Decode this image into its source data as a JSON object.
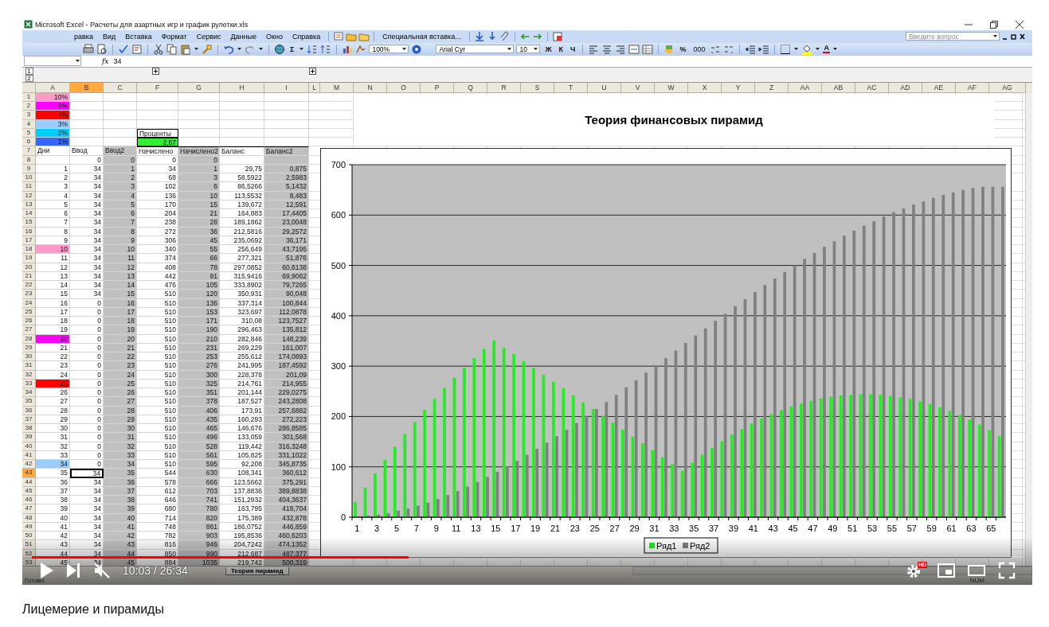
{
  "video": {
    "window": {
      "title": "Microsoft Excel - Расчеты для азартных игр и график рулетки.xls"
    },
    "menu": [
      "равка",
      "Вид",
      "Вставка",
      "Формат",
      "Сервис",
      "Данные",
      "Окно",
      "Справка"
    ],
    "special_paste": "Специальная вставка...",
    "help_search": {
      "placeholder": "Введите вопрос"
    },
    "toolbar": {
      "sum": "Σ",
      "zoom": "100%",
      "font": "Arial Cyr",
      "font_size": "10",
      "format_buttons": [
        "Ж",
        "К",
        "Ч"
      ],
      "percent": "%",
      "thousands": "000",
      "font_color_letter": "A"
    },
    "formula_bar": {
      "fx": "fx",
      "value": "34"
    },
    "outline_levels": [
      "1",
      "2"
    ],
    "columns": [
      {
        "label": "A",
        "selected": false,
        "shaded": false
      },
      {
        "label": "B",
        "selected": true,
        "shaded": false
      },
      {
        "label": "C",
        "selected": false,
        "shaded": true
      },
      {
        "label": "F",
        "selected": false,
        "shaded": false
      },
      {
        "label": "G",
        "selected": false,
        "shaded": true
      },
      {
        "label": "H",
        "selected": false,
        "shaded": false
      },
      {
        "label": "I",
        "selected": false,
        "shaded": true
      },
      {
        "label": "L",
        "selected": false
      },
      {
        "label": "M",
        "selected": false
      },
      {
        "label": "N",
        "selected": false
      },
      {
        "label": "O",
        "selected": false
      },
      {
        "label": "P",
        "selected": false
      },
      {
        "label": "Q",
        "selected": false
      },
      {
        "label": "R",
        "selected": false
      },
      {
        "label": "S",
        "selected": false
      },
      {
        "label": "T",
        "selected": false
      },
      {
        "label": "U",
        "selected": false
      },
      {
        "label": "V",
        "selected": false
      },
      {
        "label": "W",
        "selected": false
      },
      {
        "label": "X",
        "selected": false
      },
      {
        "label": "Y",
        "selected": false
      },
      {
        "label": "Z",
        "selected": false
      },
      {
        "label": "AA",
        "selected": false
      },
      {
        "label": "AB",
        "selected": false
      },
      {
        "label": "AC",
        "selected": false
      },
      {
        "label": "AD",
        "selected": false
      },
      {
        "label": "AE",
        "selected": false
      },
      {
        "label": "AF",
        "selected": false
      },
      {
        "label": "AG",
        "selected": false
      }
    ],
    "rows": [
      {
        "n": "1",
        "selected": false,
        "kind": "top",
        "cells": [
          {
            "text": "10%",
            "color": "#ff99cc"
          },
          null,
          null,
          null,
          null,
          null,
          null
        ]
      },
      {
        "n": "2",
        "selected": false,
        "kind": "top",
        "cells": [
          {
            "text": "5%",
            "color": "#ff00ff"
          },
          null,
          null,
          null,
          null,
          null,
          null
        ]
      },
      {
        "n": "3",
        "selected": false,
        "kind": "top",
        "cells": [
          {
            "text": "4%",
            "color": "#ff0000"
          },
          null,
          null,
          null,
          null,
          null,
          null
        ]
      },
      {
        "n": "4",
        "selected": false,
        "kind": "top",
        "cells": [
          {
            "text": "3%",
            "color": "#99ccff"
          },
          null,
          null,
          null,
          null,
          null,
          null
        ]
      },
      {
        "n": "5",
        "selected": false,
        "kind": "top",
        "cells": [
          {
            "text": "2%",
            "color": "#00ccff"
          },
          null,
          null,
          {
            "text": "Проценты",
            "kind": "label"
          },
          null,
          null,
          null
        ]
      },
      {
        "n": "6",
        "selected": false,
        "kind": "top",
        "cells": [
          {
            "text": "1%",
            "color": "#3366ff"
          },
          null,
          null,
          {
            "text": "2,67",
            "kind": "value",
            "color": "#33ee33"
          },
          null,
          null,
          null
        ]
      },
      {
        "n": "7",
        "selected": false,
        "kind": "header",
        "cells": [
          "Дни",
          "Ввод",
          "Ввод2",
          "Начислено",
          "Начислено2",
          "Баланс",
          "Баланс2"
        ]
      },
      {
        "n": "8",
        "selected": false,
        "kind": "data",
        "cells": [
          null,
          "0",
          "0",
          "0",
          "0",
          null,
          null
        ]
      },
      {
        "n": "9",
        "selected": false,
        "kind": "data",
        "cells": [
          "1",
          "34",
          "1",
          "34",
          "1",
          "29,75",
          "0,875"
        ]
      },
      {
        "n": "10",
        "selected": false,
        "kind": "data",
        "cells": [
          "2",
          "34",
          "2",
          "68",
          "3",
          "58,5922",
          "2,5983"
        ]
      },
      {
        "n": "11",
        "selected": false,
        "kind": "data",
        "cells": [
          "3",
          "34",
          "3",
          "102",
          "6",
          "86,5266",
          "5,1432"
        ]
      },
      {
        "n": "12",
        "selected": false,
        "kind": "data",
        "cells": [
          "4",
          "34",
          "4",
          "136",
          "10",
          "113,5532",
          "8,483"
        ]
      },
      {
        "n": "13",
        "selected": false,
        "kind": "data",
        "cells": [
          "5",
          "34",
          "5",
          "170",
          "15",
          "139,672",
          "12,591"
        ]
      },
      {
        "n": "14",
        "selected": false,
        "kind": "data",
        "cells": [
          "6",
          "34",
          "6",
          "204",
          "21",
          "164,883",
          "17,4405"
        ]
      },
      {
        "n": "15",
        "selected": false,
        "kind": "data",
        "cells": [
          "7",
          "34",
          "7",
          "238",
          "28",
          "189,1862",
          "23,0048"
        ]
      },
      {
        "n": "16",
        "selected": false,
        "kind": "data",
        "cells": [
          "8",
          "34",
          "8",
          "272",
          "36",
          "212,5816",
          "29,2572"
        ]
      },
      {
        "n": "17",
        "selected": false,
        "kind": "data",
        "cells": [
          "9",
          "34",
          "9",
          "306",
          "45",
          "235,0692",
          "36,171"
        ]
      },
      {
        "n": "18",
        "selected": false,
        "kind": "data",
        "cells": [
          {
            "text": "10",
            "color": "#ff99cc"
          },
          "34",
          "10",
          "340",
          "55",
          "256,649",
          "43,7195"
        ]
      },
      {
        "n": "19",
        "selected": false,
        "kind": "data",
        "cells": [
          "11",
          "34",
          "11",
          "374",
          "66",
          "277,321",
          "51,876"
        ]
      },
      {
        "n": "20",
        "selected": false,
        "kind": "data",
        "cells": [
          "12",
          "34",
          "12",
          "408",
          "78",
          "297,0852",
          "60,6138"
        ]
      },
      {
        "n": "21",
        "selected": false,
        "kind": "data",
        "cells": [
          "13",
          "34",
          "13",
          "442",
          "91",
          "315,9416",
          "69,9062"
        ]
      },
      {
        "n": "22",
        "selected": false,
        "kind": "data",
        "cells": [
          "14",
          "34",
          "14",
          "476",
          "105",
          "333,8902",
          "79,7265"
        ]
      },
      {
        "n": "23",
        "selected": false,
        "kind": "data",
        "cells": [
          "15",
          "34",
          "15",
          "510",
          "120",
          "350,931",
          "90,048"
        ]
      },
      {
        "n": "24",
        "selected": false,
        "kind": "data",
        "cells": [
          "16",
          "0",
          "16",
          "510",
          "136",
          "337,314",
          "100,844"
        ]
      },
      {
        "n": "25",
        "selected": false,
        "kind": "data",
        "cells": [
          "17",
          "0",
          "17",
          "510",
          "153",
          "323,697",
          "112,0878"
        ]
      },
      {
        "n": "26",
        "selected": false,
        "kind": "data",
        "cells": [
          "18",
          "0",
          "18",
          "510",
          "171",
          "310,08",
          "123,7527"
        ]
      },
      {
        "n": "27",
        "selected": false,
        "kind": "data",
        "cells": [
          "19",
          "0",
          "19",
          "510",
          "190",
          "296,463",
          "135,812"
        ]
      },
      {
        "n": "28",
        "selected": false,
        "kind": "data",
        "cells": [
          {
            "text": "20",
            "color": "#ff00ff"
          },
          "0",
          "20",
          "510",
          "210",
          "282,846",
          "148,239"
        ]
      },
      {
        "n": "29",
        "selected": false,
        "kind": "data",
        "cells": [
          "21",
          "0",
          "21",
          "510",
          "231",
          "269,229",
          "161,007"
        ]
      },
      {
        "n": "30",
        "selected": false,
        "kind": "data",
        "cells": [
          "22",
          "0",
          "22",
          "510",
          "253",
          "255,612",
          "174,0893"
        ]
      },
      {
        "n": "31",
        "selected": false,
        "kind": "data",
        "cells": [
          "23",
          "0",
          "23",
          "510",
          "276",
          "241,995",
          "187,4592"
        ]
      },
      {
        "n": "32",
        "selected": false,
        "kind": "data",
        "cells": [
          "24",
          "0",
          "24",
          "510",
          "300",
          "228,378",
          "201,09"
        ]
      },
      {
        "n": "33",
        "selected": false,
        "kind": "data",
        "cells": [
          {
            "text": "25",
            "color": "#ff0000"
          },
          "0",
          "25",
          "510",
          "325",
          "214,761",
          "214,955"
        ]
      },
      {
        "n": "34",
        "selected": false,
        "kind": "data",
        "cells": [
          "26",
          "0",
          "26",
          "510",
          "351",
          "201,144",
          "229,0275"
        ]
      },
      {
        "n": "35",
        "selected": false,
        "kind": "data",
        "cells": [
          "27",
          "0",
          "27",
          "510",
          "378",
          "187,527",
          "243,2808"
        ]
      },
      {
        "n": "36",
        "selected": false,
        "kind": "data",
        "cells": [
          "28",
          "0",
          "28",
          "510",
          "406",
          "173,91",
          "257,6882"
        ]
      },
      {
        "n": "37",
        "selected": false,
        "kind": "data",
        "cells": [
          "29",
          "0",
          "29",
          "510",
          "435",
          "160,293",
          "272,223"
        ]
      },
      {
        "n": "38",
        "selected": false,
        "kind": "data",
        "cells": [
          "30",
          "0",
          "30",
          "510",
          "465",
          "146,676",
          "286,8585"
        ]
      },
      {
        "n": "39",
        "selected": false,
        "kind": "data",
        "cells": [
          "31",
          "0",
          "31",
          "510",
          "496",
          "133,059",
          "301,568"
        ]
      },
      {
        "n": "40",
        "selected": false,
        "kind": "data",
        "cells": [
          "32",
          "0",
          "32",
          "510",
          "528",
          "119,442",
          "316,3248"
        ]
      },
      {
        "n": "41",
        "selected": false,
        "kind": "data",
        "cells": [
          "33",
          "0",
          "33",
          "510",
          "561",
          "105,825",
          "331,1022"
        ]
      },
      {
        "n": "42",
        "selected": false,
        "kind": "data",
        "cells": [
          {
            "text": "34",
            "color": "#99ccff"
          },
          "0",
          "34",
          "510",
          "595",
          "92,208",
          "345,8735"
        ]
      },
      {
        "n": "43",
        "selected": true,
        "kind": "data",
        "cells": [
          "35",
          {
            "text": "34",
            "kind": "active"
          },
          "35",
          "544",
          "630",
          "108,341",
          "360,612"
        ]
      },
      {
        "n": "44",
        "selected": false,
        "kind": "data",
        "cells": [
          "36",
          "34",
          "36",
          "578",
          "666",
          "123,5662",
          "375,291"
        ]
      },
      {
        "n": "45",
        "selected": false,
        "kind": "data",
        "cells": [
          "37",
          "34",
          "37",
          "612",
          "703",
          "137,8836",
          "389,8838"
        ]
      },
      {
        "n": "46",
        "selected": false,
        "kind": "data",
        "cells": [
          "38",
          "34",
          "38",
          "646",
          "741",
          "151,2932",
          "404,3637"
        ]
      },
      {
        "n": "47",
        "selected": false,
        "kind": "data",
        "cells": [
          "39",
          "34",
          "39",
          "680",
          "780",
          "163,795",
          "418,704"
        ]
      },
      {
        "n": "48",
        "selected": false,
        "kind": "data",
        "cells": [
          "40",
          "34",
          "40",
          "714",
          "820",
          "175,389",
          "432,878"
        ]
      },
      {
        "n": "49",
        "selected": false,
        "kind": "data",
        "cells": [
          "41",
          "34",
          "41",
          "748",
          "861",
          "186,0752",
          "446,859"
        ]
      },
      {
        "n": "50",
        "selected": false,
        "kind": "data",
        "cells": [
          "42",
          "34",
          "42",
          "782",
          "903",
          "195,8536",
          "460,6203"
        ]
      },
      {
        "n": "51",
        "selected": false,
        "kind": "data",
        "cells": [
          "43",
          "34",
          "43",
          "816",
          "946",
          "204,7242",
          "474,1352"
        ]
      },
      {
        "n": "52",
        "selected": false,
        "kind": "data",
        "cells": [
          "44",
          "34",
          "44",
          "850",
          "990",
          "212,687",
          "487,377"
        ]
      },
      {
        "n": "53",
        "selected": false,
        "kind": "data",
        "cells": [
          "45",
          "34",
          "45",
          "884",
          "1035",
          "219,742",
          "500,319"
        ]
      }
    ],
    "chart": {
      "chart_data": {
        "type": "bar",
        "title": "Теория финансовых пирамид",
        "x": [
          1,
          2,
          3,
          4,
          5,
          6,
          7,
          8,
          9,
          10,
          11,
          12,
          13,
          14,
          15,
          16,
          17,
          18,
          19,
          20,
          21,
          22,
          23,
          24,
          25,
          26,
          27,
          28,
          29,
          30,
          31,
          32,
          33,
          34,
          35,
          36,
          37,
          38,
          39,
          40,
          41,
          42,
          43,
          44,
          45,
          46,
          47,
          48,
          49,
          50,
          51,
          52,
          53,
          54,
          55,
          56,
          57,
          58,
          59,
          60,
          61,
          62,
          63,
          64,
          65,
          66
        ],
        "xticks": [
          1,
          3,
          5,
          7,
          9,
          11,
          13,
          15,
          17,
          19,
          21,
          23,
          25,
          27,
          29,
          31,
          33,
          35,
          37,
          39,
          41,
          43,
          45,
          47,
          49,
          51,
          53,
          55,
          57,
          59,
          61,
          63,
          65
        ],
        "series": [
          {
            "name": "Ряд1",
            "color": "#22ee22",
            "values": [
              30,
              59,
              87,
              114,
              140,
              165,
              189,
              213,
              235,
              257,
              277,
              297,
              316,
              334,
              351,
              337,
              324,
              310,
              296,
              283,
              269,
              256,
              242,
              228,
              215,
              201,
              188,
              174,
              160,
              147,
              133,
              119,
              106,
              92,
              108,
              124,
              138,
              151,
              164,
              175,
              186,
              196,
              205,
              213,
              220,
              226,
              231,
              236,
              239,
              242,
              243,
              244,
              244,
              243,
              241,
              238,
              235,
              230,
              225,
              218,
              211,
              203,
              194,
              184,
              173,
              161
            ]
          },
          {
            "name": "Ряд2",
            "color": "#808080",
            "values": [
              1,
              3,
              5,
              8,
              13,
              17,
              23,
              29,
              36,
              44,
              52,
              61,
              70,
              80,
              90,
              101,
              112,
              124,
              136,
              148,
              161,
              174,
              187,
              201,
              215,
              229,
              243,
              258,
              272,
              287,
              302,
              316,
              331,
              346,
              361,
              375,
              390,
              404,
              419,
              433,
              447,
              461,
              474,
              487,
              500,
              513,
              525,
              537,
              548,
              559,
              569,
              579,
              588,
              597,
              606,
              613,
              621,
              627,
              634,
              640,
              645,
              650,
              654,
              656,
              656,
              656
            ]
          }
        ],
        "xlim": [
          0.5,
          66.5
        ],
        "stacked": false,
        "ylim": [
          0,
          700
        ],
        "yticks": [
          0,
          100,
          200,
          300,
          400,
          500,
          600,
          700
        ],
        "grid": true,
        "legend": "bottom"
      }
    },
    "sheet_tabs": [
      {
        "label": "Теория пирамид",
        "selected": true
      }
    ],
    "status_bar": {
      "text": "Готово",
      "indicator": "NUM"
    },
    "player": {
      "progress": {
        "level": 0.38
      },
      "time": "10:03 / 26:34",
      "quality_badge": "HD",
      "muted": true
    }
  },
  "video_title": "Лицемерие и пирамиды"
}
